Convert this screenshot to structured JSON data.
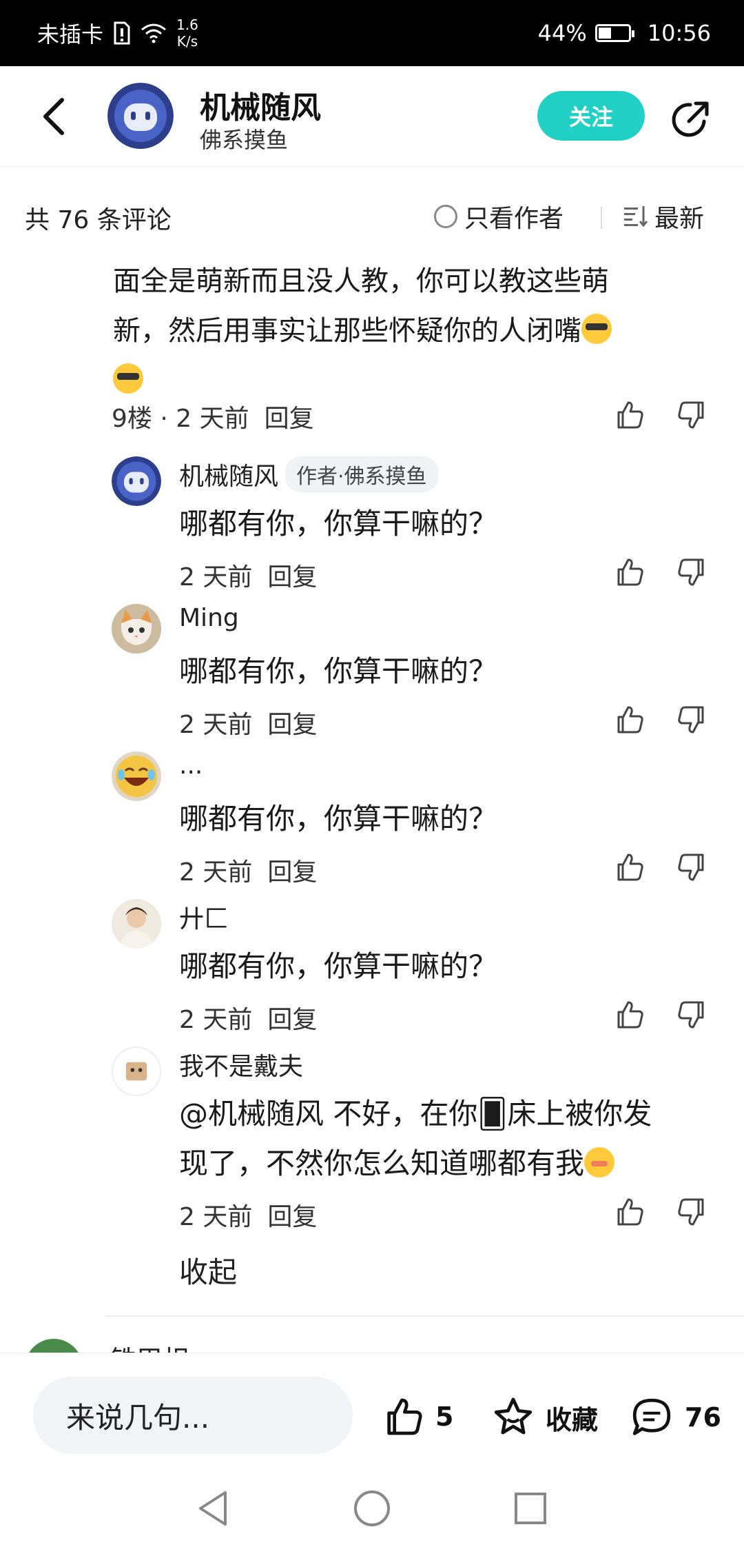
{
  "status_bar": {
    "carrier": "未插卡",
    "speed_value": "1.6",
    "speed_unit": "K/s",
    "battery": "44%",
    "battery_level": 0.44,
    "time": "10:56"
  },
  "header": {
    "author_name": "机械随风",
    "author_subtitle": "佛系摸鱼",
    "follow_label": "关注"
  },
  "summary": {
    "count_text": "共 76 条评论",
    "only_author_label": "只看作者",
    "sort_label": "最新"
  },
  "main_comment": {
    "text_line1": "面全是萌新而且没人教，你可以教这些萌",
    "text_line2": "新，然后用事实让那些怀疑你的人闭嘴",
    "floor": "9楼",
    "dot": "·",
    "time": "2 天前",
    "reply_label": "回复"
  },
  "replies": [
    {
      "name": "机械随风",
      "badge": "作者·佛系摸鱼",
      "text": "哪都有你，你算干嘛的？",
      "time": "2 天前",
      "reply_label": "回复"
    },
    {
      "name": "Ming",
      "text": "哪都有你，你算干嘛的？",
      "time": "2 天前",
      "reply_label": "回复"
    },
    {
      "name": "...",
      "text": "哪都有你，你算干嘛的？",
      "time": "2 天前",
      "reply_label": "回复"
    },
    {
      "name": "廾匚",
      "text": "哪都有你，你算干嘛的？",
      "time": "2 天前",
      "reply_label": "回复"
    },
    {
      "name": "我不是戴夫",
      "text_line1": "@机械随风  不好，在你🂠床上被你发",
      "text_line2": "现了，不然你怎么知道哪都有我",
      "time": "2 天前",
      "reply_label": "回复"
    }
  ],
  "collapse_label": "收起",
  "next_comment_name": "铁甲相",
  "action_bar": {
    "input_placeholder": "来说几句...",
    "like_count": "5",
    "favorite_label": "收藏",
    "comment_count": "76"
  },
  "colors": {
    "accent": "#21d0c4",
    "status_bar": "#000000"
  }
}
